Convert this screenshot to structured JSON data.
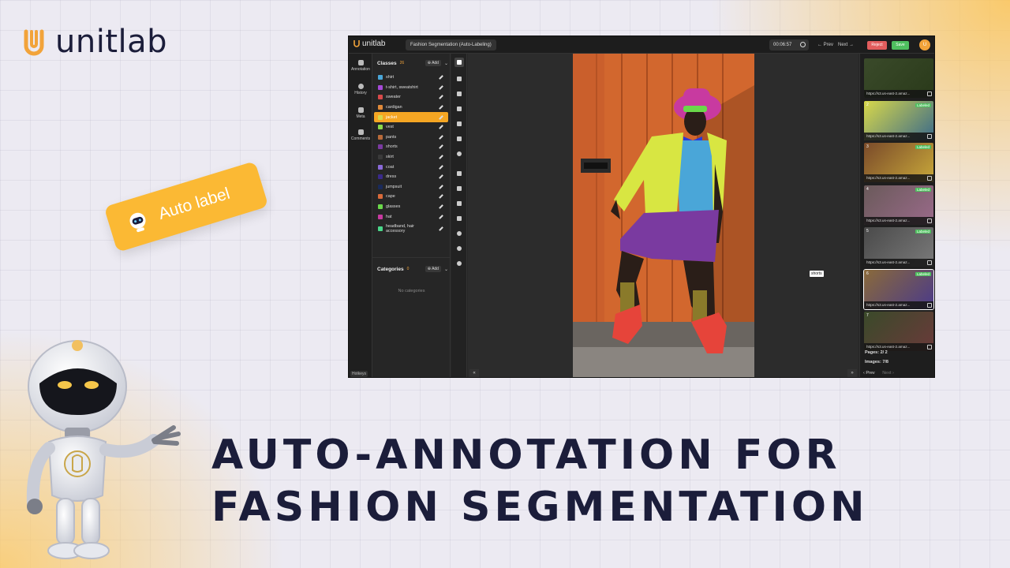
{
  "brand": {
    "name": "unitlab",
    "accent": "#f2a33a",
    "text_color": "#1b1d3a"
  },
  "auto_label": {
    "text": "Auto label",
    "color": "#fbb934"
  },
  "headline": {
    "line1": "AUTO-ANNOTATION FOR",
    "line2": "FASHION SEGMENTATION"
  },
  "app": {
    "logo": "unitlab",
    "project_title": "Fashion Segmentation (Auto-Labeling)",
    "timer": "00:06:57",
    "prev_label": "← Prev",
    "next_label": "Next →",
    "reject_label": "Reject",
    "save_label": "Save",
    "avatar_initial": "U",
    "rail": [
      {
        "label": "Annotation",
        "icon": "layers-icon"
      },
      {
        "label": "History",
        "icon": "history-icon"
      },
      {
        "label": "Meta",
        "icon": "meta-icon"
      },
      {
        "label": "Comments",
        "icon": "comments-icon"
      }
    ],
    "hotkeys_label": "Hotkeys",
    "classes": {
      "title": "Classes",
      "count": "26",
      "add_label": "⊕ Add",
      "items": [
        {
          "name": "shirt",
          "color": "#4aa6d8"
        },
        {
          "name": "t-shirt, sweatshirt",
          "color": "#a64ad8"
        },
        {
          "name": "sweater",
          "color": "#d84a4a"
        },
        {
          "name": "cardigan",
          "color": "#e08a3a"
        },
        {
          "name": "jacket",
          "color": "#d8d84a"
        },
        {
          "name": "vest",
          "color": "#8ad84a"
        },
        {
          "name": "pants",
          "color": "#b86a3a"
        },
        {
          "name": "shorts",
          "color": "#7a3aa0"
        },
        {
          "name": "skirt",
          "color": "#3a3a3a"
        },
        {
          "name": "coat",
          "color": "#8a6ad8"
        },
        {
          "name": "dress",
          "color": "#3a2a8a"
        },
        {
          "name": "jumpsuit",
          "color": "#1a2a5a"
        },
        {
          "name": "cape",
          "color": "#d86a3a"
        },
        {
          "name": "glasses",
          "color": "#6ad84a"
        },
        {
          "name": "hat",
          "color": "#c83aa0"
        },
        {
          "name": "headband, hair accessory",
          "color": "#4ad88a"
        }
      ],
      "active_index": 4
    },
    "categories": {
      "title": "Categories",
      "count": "0",
      "add_label": "⊕ Add",
      "empty_text": "No categories"
    },
    "canvas_label": "shorts",
    "thumbnails": [
      {
        "index": "",
        "url": "https://s3.us-east-2.amaz...",
        "badge": "",
        "colors": [
          "#3a4a2a",
          "#2a3a1a"
        ]
      },
      {
        "index": "2",
        "url": "https://s3.us-east-2.amaz...",
        "badge": "Labeled",
        "colors": [
          "#d8d84a",
          "#3a6a8a"
        ]
      },
      {
        "index": "3",
        "url": "https://s3.us-east-2.amaz...",
        "badge": "Labeled",
        "colors": [
          "#7a4a2a",
          "#c8a83a"
        ]
      },
      {
        "index": "4",
        "url": "https://s3.us-east-2.amaz...",
        "badge": "Labeled",
        "colors": [
          "#6a5a5a",
          "#9a6a8a"
        ]
      },
      {
        "index": "5",
        "url": "https://s3.us-east-2.amaz...",
        "badge": "Labeled",
        "colors": [
          "#4a4a4a",
          "#7a7a7a"
        ]
      },
      {
        "index": "6",
        "url": "https://s3.us-east-2.amaz...",
        "badge": "Labeled",
        "colors": [
          "#8a6a3a",
          "#4a3a8a"
        ]
      },
      {
        "index": "7",
        "url": "https://s3.us-east-2.amaz...",
        "badge": "",
        "colors": [
          "#3a4a2a",
          "#6a3a3a"
        ]
      }
    ],
    "pages": "Pages:  2/ 2",
    "images": "Images:  7/8",
    "thumbs_prev": "‹ Prev",
    "thumbs_next": "Next ›"
  }
}
